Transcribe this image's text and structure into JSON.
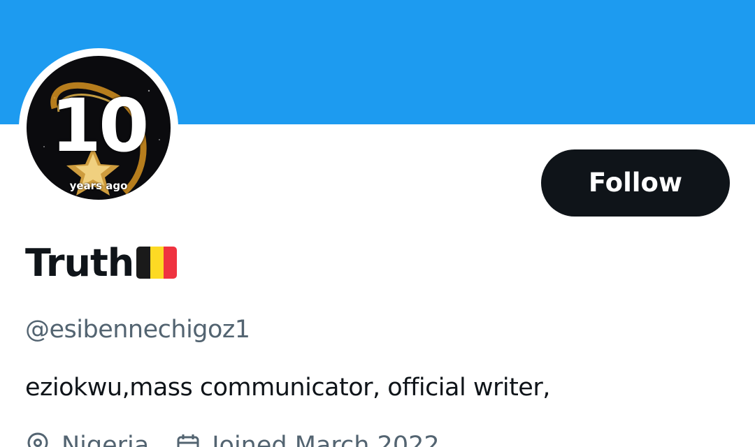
{
  "profile": {
    "display_name": "Truth",
    "name_emoji": "belgium-flag",
    "handle": "@esibennechigoz1",
    "bio": "eziokwu,mass communicator, official writer,",
    "location": "Nigeria",
    "joined": "Joined March 2022"
  },
  "avatar": {
    "number": "10",
    "caption": "years ago"
  },
  "actions": {
    "follow_label": "Follow"
  },
  "icons": {
    "location": "location-pin-icon",
    "joined": "calendar-icon"
  },
  "colors": {
    "banner": "#1d9bf0",
    "follow_button_bg": "#0f1419",
    "primary_text": "#0f1419",
    "secondary_text": "#536471",
    "flag_black": "#1a1a1a",
    "flag_yellow": "#fdda24",
    "flag_red": "#ef3340"
  }
}
